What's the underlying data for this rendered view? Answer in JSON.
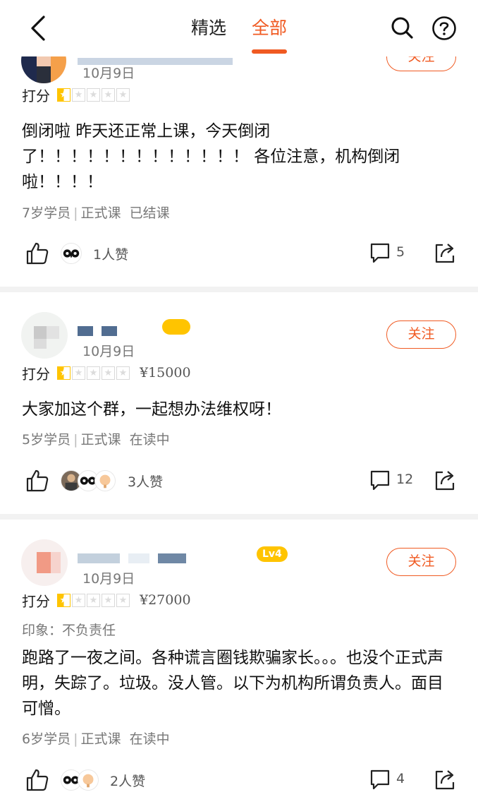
{
  "header": {
    "tabs": [
      {
        "label": "精选",
        "active": false
      },
      {
        "label": "全部",
        "active": true
      }
    ],
    "accent_color": "#f05a22"
  },
  "reviews": [
    {
      "date": "10月9日",
      "follow_label": "关注",
      "rating_label": "打分",
      "stars": 0.5,
      "content": "倒闭啦 昨天还正常上课，今天倒闭了！！！！！！！！！！！！！ 各位注意，机构倒闭啦！！！！",
      "student": "7岁学员",
      "course_type": "正式课",
      "status": "已结课",
      "likes": "1人赞",
      "comments": "5"
    },
    {
      "date": "10月9日",
      "follow_label": "关注",
      "rating_label": "打分",
      "stars": 0.5,
      "price": "¥15000",
      "content": "大家加这个群，一起想办法维权呀！",
      "student": "5岁学员",
      "course_type": "正式课",
      "status": "在读中",
      "likes": "3人赞",
      "comments": "12"
    },
    {
      "date": "10月9日",
      "follow_label": "关注",
      "level": "Lv4",
      "rating_label": "打分",
      "stars": 0.5,
      "price": "¥27000",
      "impression": "印象：不负责任",
      "content": "跑路了一夜之间。各种谎言圈钱欺骗家长。。。也没个正式声明，失踪了。垃圾。没人管。以下为机构所谓负责人。面目可憎。",
      "student": "6岁学员",
      "course_type": "正式课",
      "status": "在读中",
      "likes": "2人赞",
      "comments": "4"
    }
  ]
}
